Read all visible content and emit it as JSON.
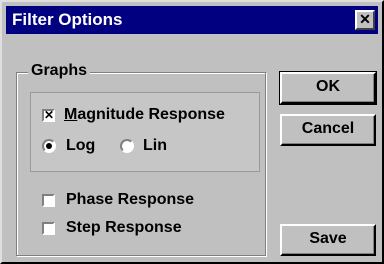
{
  "window": {
    "title": "Filter Options",
    "close_glyph": "✕"
  },
  "graphs_group": {
    "label": "Graphs",
    "magnitude": {
      "label": "Magnitude Response",
      "checked": true
    },
    "scale": {
      "options": [
        {
          "label": "Log",
          "selected": true
        },
        {
          "label": "Lin",
          "selected": false
        }
      ]
    },
    "phase": {
      "label": "Phase Response",
      "checked": false
    },
    "step": {
      "label": "Step Response",
      "checked": false
    }
  },
  "buttons": {
    "ok": "OK",
    "cancel": "Cancel",
    "save": "Save"
  },
  "icons": {
    "checkmark": "checkbox-x-icon"
  }
}
